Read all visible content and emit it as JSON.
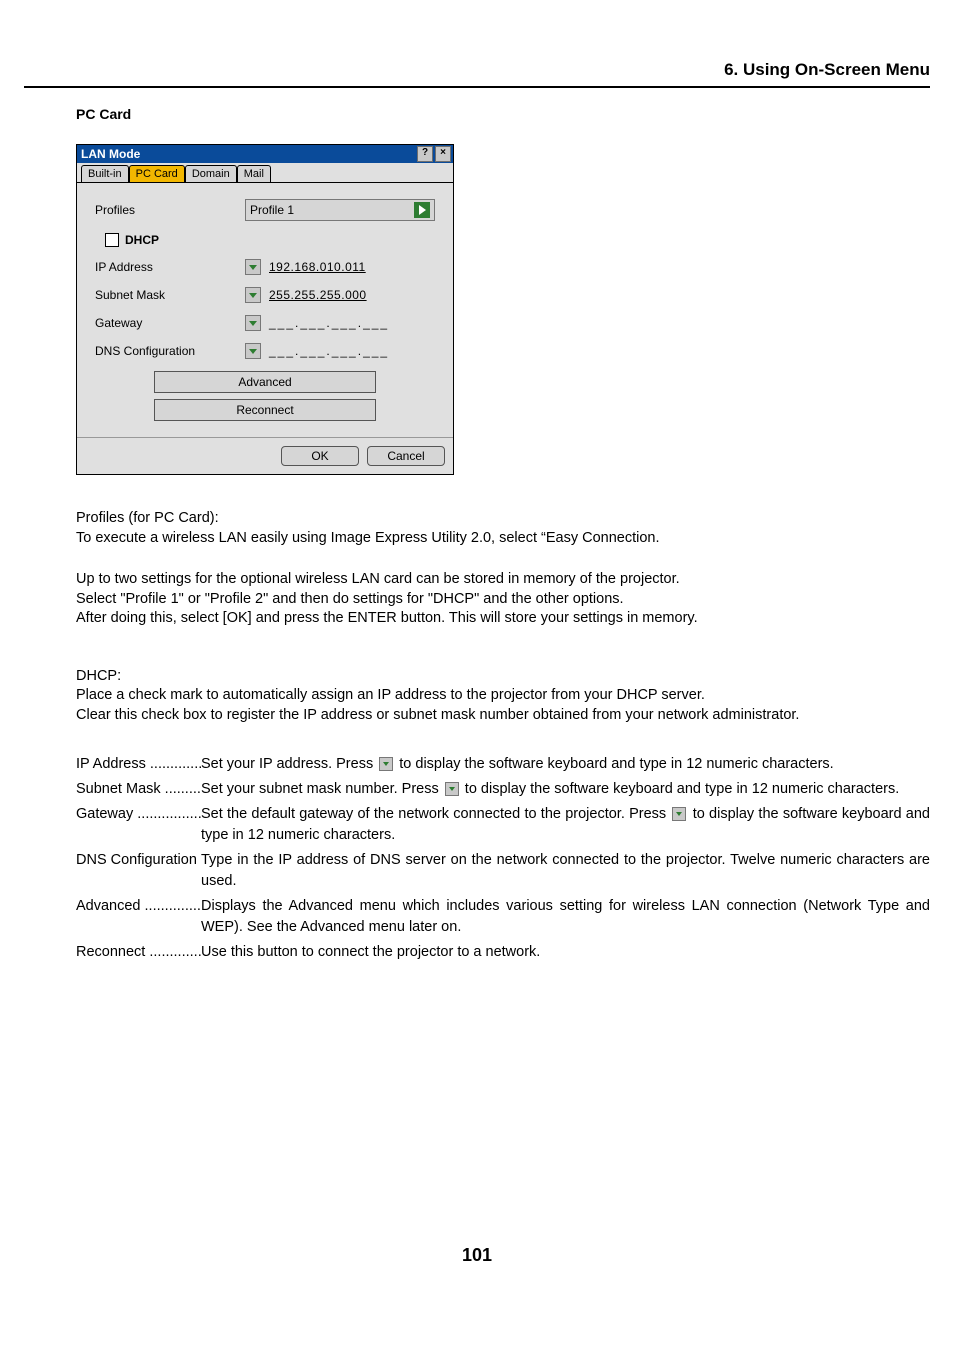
{
  "header": {
    "section": "6. Using On-Screen Menu"
  },
  "subhead": "PC Card",
  "dialog": {
    "title": "LAN Mode",
    "tabs": [
      "Built-in",
      "PC Card",
      "Domain",
      "Mail"
    ],
    "active_tab_index": 1,
    "profiles_label": "Profiles",
    "profile_value": "Profile 1",
    "dhcp_label": "DHCP",
    "rows": {
      "ip_label": "IP Address",
      "ip_value": "192.168.010.011",
      "subnet_label": "Subnet Mask",
      "subnet_value": "255.255.255.000",
      "gateway_label": "Gateway",
      "gateway_value": "___.___.___.___",
      "dns_label": "DNS Configuration",
      "dns_value": "___.___.___.___"
    },
    "advanced_btn": "Advanced",
    "reconnect_btn": "Reconnect",
    "ok_btn": "OK",
    "cancel_btn": "Cancel"
  },
  "paragraphs": {
    "p1_l1": "Profiles (for PC Card):",
    "p1_l2": "To execute a wireless LAN easily using Image Express Utility 2.0, select “Easy Connection.",
    "p2_l1": "Up to two settings for the optional wireless LAN card can be stored in memory of the projector.",
    "p2_l2": "Select \"Profile 1\" or \"Profile 2\" and then do settings for \"DHCP\" and the other options.",
    "p2_l3": "After doing this, select [OK] and press the ENTER button. This will store your settings in memory.",
    "p3_l1": "DHCP:",
    "p3_l2": "Place a check mark to automatically assign an IP address to the projector from your DHCP server.",
    "p3_l3": "Clear this check box to register the IP address or subnet mask number obtained from your network administrator."
  },
  "defs": {
    "ip": {
      "term": "IP Address",
      "pre": "Set your IP address. Press ",
      "post": " to display the software keyboard and type in 12 numeric characters."
    },
    "subnet": {
      "term": "Subnet Mask",
      "pre": "Set your subnet mask number. Press ",
      "post": " to display the software keyboard and type in 12 numeric characters."
    },
    "gateway": {
      "term": "Gateway",
      "pre": "Set the default gateway of the network connected to the projector. Press ",
      "post": " to display the software keyboard and type in 12 numeric characters."
    },
    "dns": {
      "term": "DNS Configuration",
      "desc": "Type in the IP address of DNS server on the network connected to the projector. Twelve numeric characters are used."
    },
    "advanced": {
      "term": "Advanced",
      "desc": "Displays the Advanced menu which includes various setting for wireless LAN connection (Network Type and WEP). See the Advanced menu later on."
    },
    "reconnect": {
      "term": "Reconnect",
      "desc": "Use this button to connect the projector to a network."
    }
  },
  "page_number": "101"
}
